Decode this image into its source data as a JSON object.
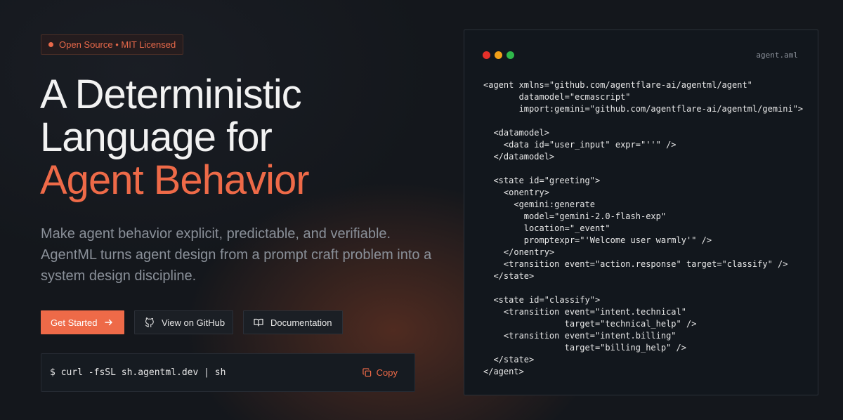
{
  "hero": {
    "badge": "Open Source • MIT Licensed",
    "headline_line1": "A Deterministic",
    "headline_line2": "Language for",
    "headline_accent": "Agent Behavior",
    "subtitle": "Make agent behavior explicit, predictable, and verifiable. AgentML turns agent design from a prompt craft problem into a system design discipline."
  },
  "buttons": {
    "get_started": "Get Started",
    "github": "View on GitHub",
    "docs": "Documentation"
  },
  "install": {
    "command": "$ curl -fsSL sh.agentml.dev | sh",
    "copy_label": "Copy"
  },
  "code_window": {
    "filename": "agent.aml",
    "dot_colors": [
      "#e5302a",
      "#f2a018",
      "#2fb84a"
    ],
    "lines": [
      "<agent xmlns=\"github.com/agentflare-ai/agentml/agent\"",
      "       datamodel=\"ecmascript\"",
      "       import:gemini=\"github.com/agentflare-ai/agentml/gemini\">",
      "",
      "  <datamodel>",
      "    <data id=\"user_input\" expr=\"''\" />",
      "  </datamodel>",
      "",
      "  <state id=\"greeting\">",
      "    <onentry>",
      "      <gemini:generate",
      "        model=\"gemini-2.0-flash-exp\"",
      "        location=\"_event\"",
      "        promptexpr=\"'Welcome user warmly'\" />",
      "    </onentry>",
      "    <transition event=\"action.response\" target=\"classify\" />",
      "  </state>",
      "",
      "  <state id=\"classify\">",
      "    <transition event=\"intent.technical\"",
      "                target=\"technical_help\" />",
      "    <transition event=\"intent.billing\"",
      "                target=\"billing_help\" />",
      "  </state>",
      "</agent>"
    ]
  },
  "colors": {
    "accent": "#ee6a48",
    "background": "#14171c"
  }
}
